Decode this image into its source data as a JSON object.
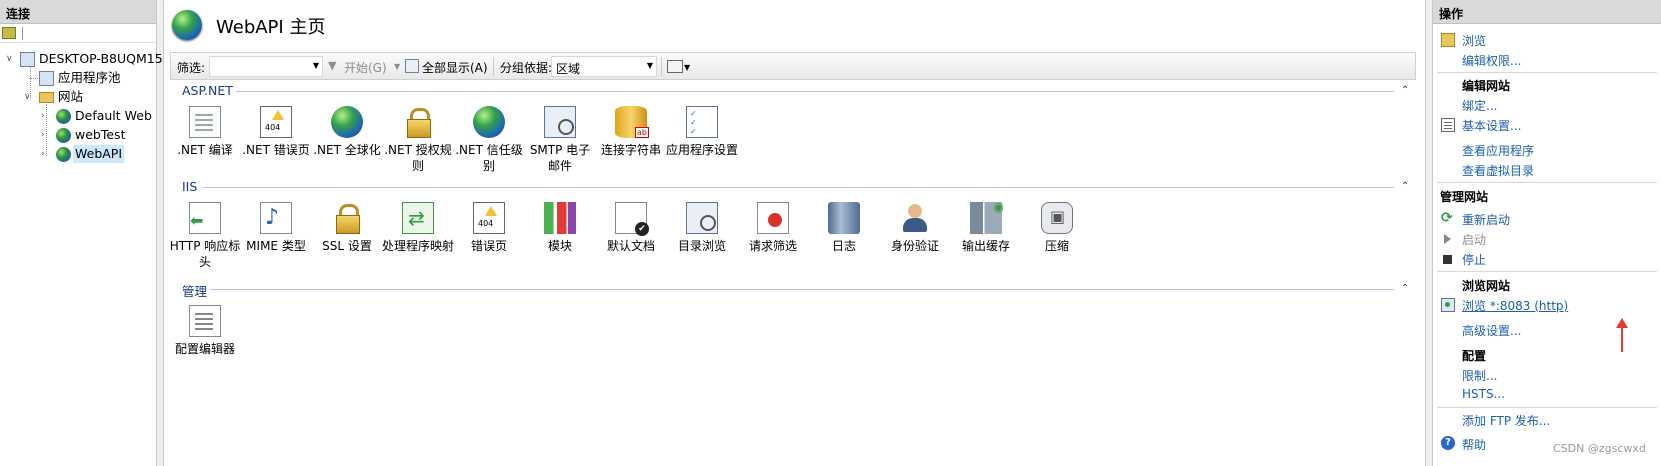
{
  "left_pane": {
    "title": "连接",
    "tree": [
      {
        "label": "DESKTOP-B8UQM15"
      },
      {
        "label": "应用程序池"
      },
      {
        "label": "网站"
      },
      {
        "label": "Default Web Site"
      },
      {
        "label": "webTest"
      },
      {
        "label": "WebAPI"
      }
    ]
  },
  "header": {
    "title": "WebAPI 主页"
  },
  "filterbar": {
    "filter_label": "筛选:",
    "filter_value": "",
    "start_label": "开始(G)",
    "show_all_label": "全部显示(A)",
    "group_by_label": "分组依据:",
    "group_by_value": "区域"
  },
  "groups": [
    {
      "name": "ASP.NET",
      "features": [
        {
          "label": ".NET 编译",
          "icon": "compile-icon"
        },
        {
          "label": ".NET 错误页",
          "icon": "error-page-icon"
        },
        {
          "label": ".NET 全球化",
          "icon": "globe-icon"
        },
        {
          "label": ".NET 授权规则",
          "icon": "auth-rules-icon"
        },
        {
          "label": ".NET 信任级别",
          "icon": "trust-level-icon"
        },
        {
          "label": "SMTP 电子邮件",
          "icon": "smtp-icon"
        },
        {
          "label": "连接字符串",
          "icon": "database-icon"
        },
        {
          "label": "应用程序设置",
          "icon": "checklist-icon"
        }
      ]
    },
    {
      "name": "IIS",
      "features": [
        {
          "label": "HTTP 响应标头",
          "icon": "http-headers-icon"
        },
        {
          "label": "MIME 类型",
          "icon": "mime-icon"
        },
        {
          "label": "SSL 设置",
          "icon": "lock-icon"
        },
        {
          "label": "处理程序映射",
          "icon": "handler-icon"
        },
        {
          "label": "错误页",
          "icon": "error-page-icon"
        },
        {
          "label": "模块",
          "icon": "modules-icon"
        },
        {
          "label": "默认文档",
          "icon": "default-doc-icon"
        },
        {
          "label": "目录浏览",
          "icon": "directory-browse-icon"
        },
        {
          "label": "请求筛选",
          "icon": "request-filter-icon"
        },
        {
          "label": "日志",
          "icon": "log-icon"
        },
        {
          "label": "身份验证",
          "icon": "user-icon"
        },
        {
          "label": "输出缓存",
          "icon": "cache-icon"
        },
        {
          "label": "压缩",
          "icon": "compress-icon"
        }
      ]
    },
    {
      "name": "管理",
      "features": [
        {
          "label": "配置编辑器",
          "icon": "config-editor-icon"
        }
      ]
    }
  ],
  "right_pane": {
    "title": "操作",
    "browse": "浏览",
    "edit_permissions": "编辑权限...",
    "edit_site_title": "编辑网站",
    "bindings": "绑定...",
    "basic_settings": "基本设置...",
    "view_apps": "查看应用程序",
    "view_vdirs": "查看虚拟目录",
    "manage_site_title": "管理网站",
    "restart": "重新启动",
    "start": "启动",
    "stop": "停止",
    "browse_site_title": "浏览网站",
    "browse_link": "浏览 *:8083 (http)",
    "advanced_settings": "高级设置...",
    "config_title": "配置",
    "limits": "限制...",
    "hsts": "HSTS...",
    "add_ftp": "添加 FTP 发布...",
    "help": "帮助"
  },
  "watermark": "CSDN @zgscwxd",
  "annotation_color": "#e53935"
}
